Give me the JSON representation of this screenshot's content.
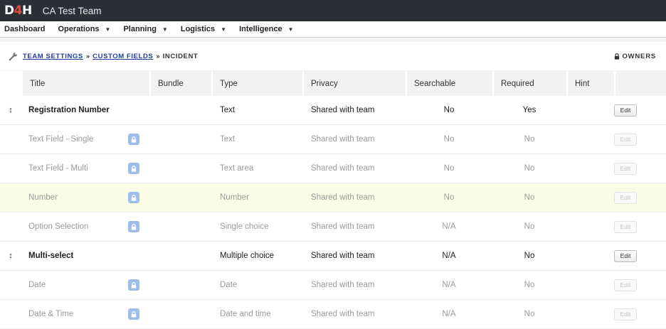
{
  "app": {
    "logo": {
      "d": "D",
      "four": "4",
      "h": "H"
    },
    "team_name": "CA Test Team"
  },
  "menu": [
    {
      "label": "Dashboard",
      "has_dropdown": false
    },
    {
      "label": "Operations",
      "has_dropdown": true
    },
    {
      "label": "Planning",
      "has_dropdown": true
    },
    {
      "label": "Logistics",
      "has_dropdown": true
    },
    {
      "label": "Intelligence",
      "has_dropdown": true
    }
  ],
  "breadcrumb": {
    "icon": "wrench-icon",
    "link1": "TEAM SETTINGS",
    "sep": "»",
    "link2": "CUSTOM FIELDS",
    "current": "INCIDENT"
  },
  "owners": {
    "label": "OWNERS",
    "icon": "lock-icon"
  },
  "table": {
    "headers": {
      "title": "Title",
      "bundle": "Bundle",
      "type": "Type",
      "privacy": "Privacy",
      "searchable": "Searchable",
      "required": "Required",
      "hint": "Hint"
    },
    "edit_label": "Edit",
    "rows": [
      {
        "title": "Registration Number",
        "type": "Text",
        "privacy": "Shared with team",
        "searchable": "No",
        "required": "Yes",
        "locked": false,
        "draggable": true,
        "editable": true
      },
      {
        "title": "Text Field - Single",
        "type": "Text",
        "privacy": "Shared with team",
        "searchable": "No",
        "required": "No",
        "locked": true,
        "draggable": false,
        "editable": false
      },
      {
        "title": "Text Field - Multi",
        "type": "Text area",
        "privacy": "Shared with team",
        "searchable": "No",
        "required": "No",
        "locked": true,
        "draggable": false,
        "editable": false
      },
      {
        "title": "Number",
        "type": "Number",
        "privacy": "Shared with team",
        "searchable": "No",
        "required": "No",
        "locked": true,
        "draggable": false,
        "editable": false,
        "highlight": true
      },
      {
        "title": "Option Selection",
        "type": "Single choice",
        "privacy": "Shared with team",
        "searchable": "N/A",
        "required": "No",
        "locked": true,
        "draggable": false,
        "editable": false
      },
      {
        "title": "Multi-select",
        "type": "Multiple choice",
        "privacy": "Shared with team",
        "searchable": "N/A",
        "required": "No",
        "locked": false,
        "draggable": true,
        "editable": true
      },
      {
        "title": "Date",
        "type": "Date",
        "privacy": "Shared with team",
        "searchable": "N/A",
        "required": "No",
        "locked": true,
        "draggable": false,
        "editable": false
      },
      {
        "title": "Date & Time",
        "type": "Date and time",
        "privacy": "Shared with team",
        "searchable": "N/A",
        "required": "No",
        "locked": true,
        "draggable": false,
        "editable": false
      }
    ]
  },
  "colors": {
    "topbar_bg": "#2b2f36",
    "logo_accent": "#e34b3d",
    "link": "#1f3e9e",
    "lock_badge": "#9ebde8",
    "highlight_row": "#fbfde6"
  }
}
